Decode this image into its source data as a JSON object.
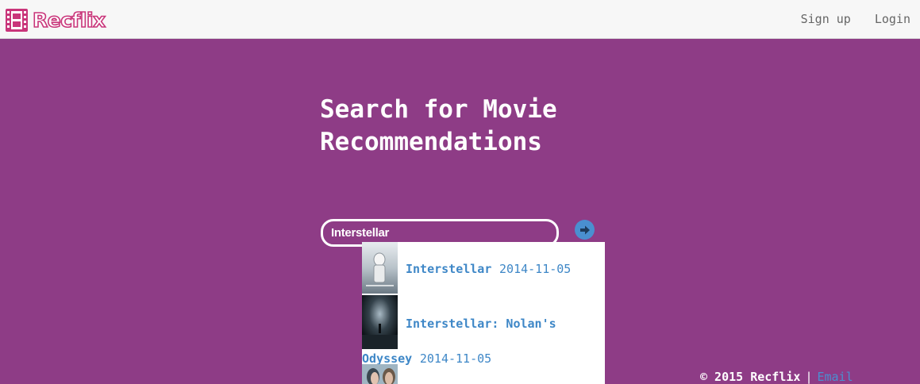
{
  "brand": {
    "name": "Recflix"
  },
  "nav": {
    "signup": "Sign up",
    "login": "Login"
  },
  "hero": {
    "title": "Search for Movie Recommendations"
  },
  "search": {
    "value": "Interstellar"
  },
  "suggestions": [
    {
      "title": "Interstellar",
      "date": "2014-11-05"
    },
    {
      "title_line1": "Interstellar: Nolan's",
      "title_line2": "Odyssey",
      "date": "2014-11-05"
    }
  ],
  "footer": {
    "copyright": "© 2015 Recflix",
    "separator": "|",
    "email": "Email"
  },
  "colors": {
    "background": "#8e3c86",
    "navbar": "#f7f7f7",
    "accent": "#4a8fd0",
    "brand": "#c9357a"
  }
}
